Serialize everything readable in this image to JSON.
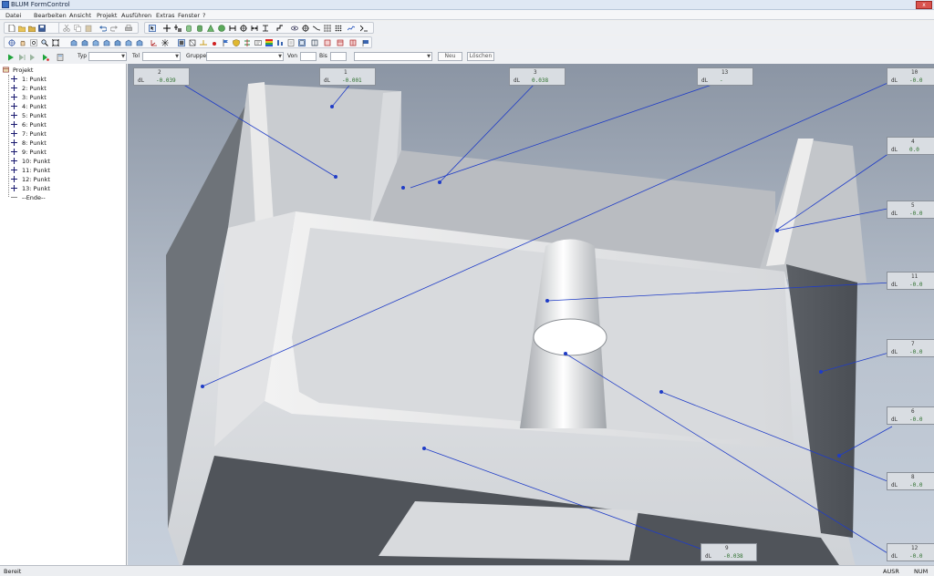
{
  "window": {
    "title": "BLUM FormControl",
    "close_label": "x"
  },
  "menu": [
    "Datei",
    "Bearbeiten",
    "Ansicht",
    "Projekt",
    "Ausführen",
    "Extras",
    "Fenster",
    "?"
  ],
  "filter_bar": {
    "typ_label": "Typ",
    "tol_label": "Tol",
    "gruppe_label": "Gruppe",
    "von_label": "Von",
    "bis_label": "Bis",
    "neu_button": "Neu",
    "loeschen_button": "Löschen"
  },
  "tree": {
    "root": "Projekt",
    "items": [
      "1: Punkt",
      "2: Punkt",
      "3: Punkt",
      "4: Punkt",
      "5: Punkt",
      "6: Punkt",
      "7: Punkt",
      "8: Punkt",
      "9: Punkt",
      "10: Punkt",
      "11: Punkt",
      "12: Punkt",
      "13: Punkt"
    ],
    "end": "--Ende--"
  },
  "callouts": [
    {
      "id": "2",
      "label": "dL",
      "value": "-0.039"
    },
    {
      "id": "1",
      "label": "dL",
      "value": "-0.001"
    },
    {
      "id": "3",
      "label": "dL",
      "value": "0.038"
    },
    {
      "id": "13",
      "label": "dL",
      "value": "-"
    },
    {
      "id": "10",
      "label": "dL",
      "value": "-0.0"
    },
    {
      "id": "4",
      "label": "dL",
      "value": "0.0"
    },
    {
      "id": "5",
      "label": "dL",
      "value": "-0.0"
    },
    {
      "id": "11",
      "label": "dL",
      "value": "-0.0"
    },
    {
      "id": "7",
      "label": "dL",
      "value": "-0.0"
    },
    {
      "id": "6",
      "label": "dL",
      "value": "-0.0"
    },
    {
      "id": "8",
      "label": "dL",
      "value": "-0.0"
    },
    {
      "id": "12",
      "label": "dL",
      "value": "-0.0"
    },
    {
      "id": "9",
      "label": "dL",
      "value": "-0.038"
    }
  ],
  "status": {
    "left": "Bereit",
    "mode": "AUSR",
    "num": "NUM"
  },
  "colors": {
    "leader": "#1f3cc7",
    "callout_bg": "#d9dde2",
    "value_text": "#2b6e2b"
  }
}
